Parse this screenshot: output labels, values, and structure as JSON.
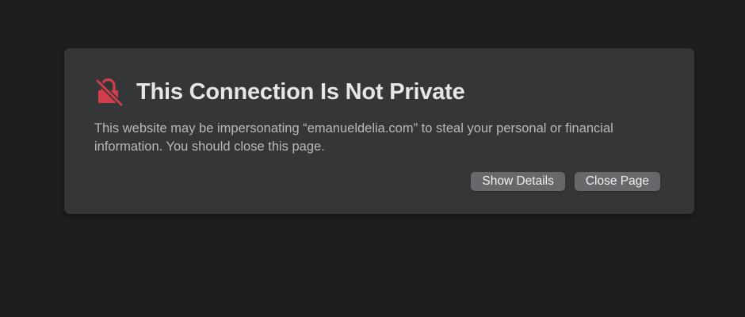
{
  "warning": {
    "title": "This Connection Is Not Private",
    "message": "This website may be impersonating “emanueldelia.com” to steal your personal or financial information. You should close this page.",
    "icon": "broken-lock-icon"
  },
  "actions": {
    "show_details_label": "Show Details",
    "close_page_label": "Close Page"
  },
  "colors": {
    "background": "#1e1e1e",
    "card": "#353638",
    "icon_red": "#d13d4a",
    "button": "#67686b"
  }
}
